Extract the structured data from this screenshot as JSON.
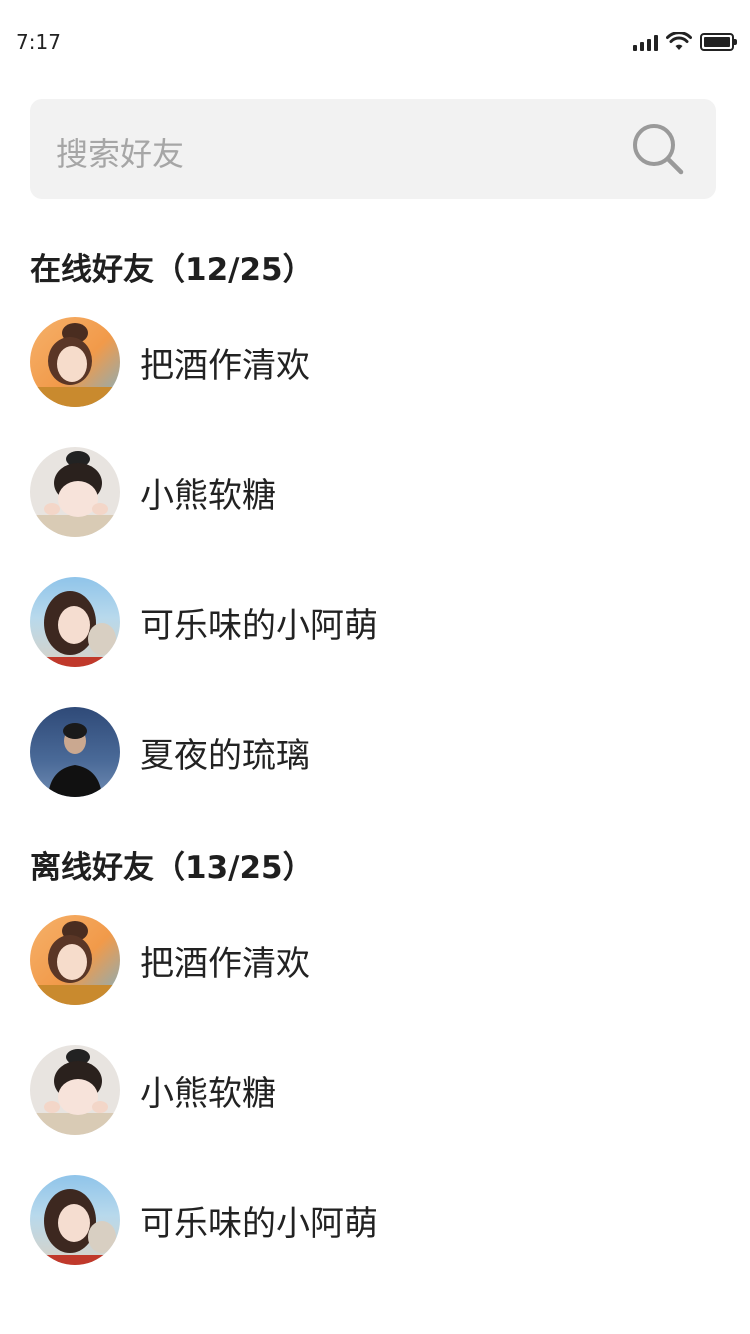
{
  "status_bar": {
    "time": "7:17"
  },
  "search": {
    "placeholder": "搜索好友"
  },
  "online": {
    "title": "在线好友（12/25）",
    "friends": [
      {
        "name": "把酒作清欢",
        "avatar": "avatar-girl-orange"
      },
      {
        "name": "小熊软糖",
        "avatar": "avatar-child"
      },
      {
        "name": "可乐味的小阿萌",
        "avatar": "avatar-girl-beach"
      },
      {
        "name": "夏夜的琉璃",
        "avatar": "avatar-man-dark"
      }
    ]
  },
  "offline": {
    "title": "离线好友（13/25）",
    "friends": [
      {
        "name": "把酒作清欢",
        "avatar": "avatar-girl-orange"
      },
      {
        "name": "小熊软糖",
        "avatar": "avatar-child"
      },
      {
        "name": "可乐味的小阿萌",
        "avatar": "avatar-girl-beach"
      }
    ]
  }
}
